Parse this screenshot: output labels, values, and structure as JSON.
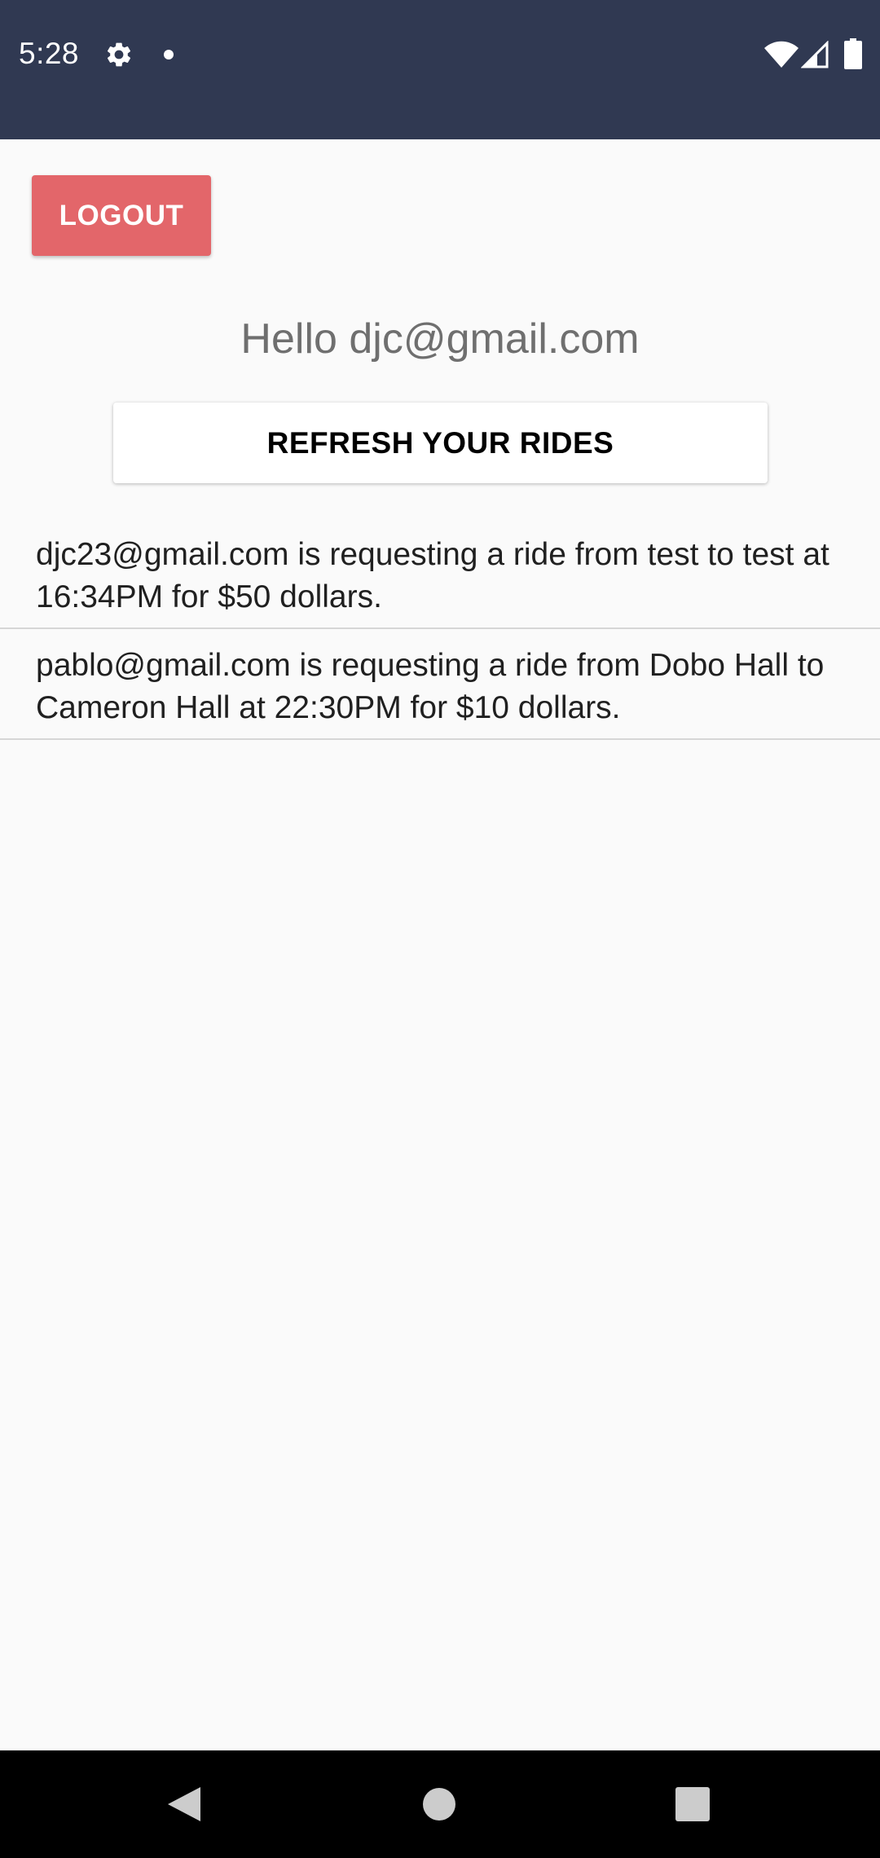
{
  "status_bar": {
    "time": "5:28",
    "icons": [
      "gear-icon",
      "notification-dot-icon",
      "wifi-icon",
      "cell-signal-icon",
      "battery-icon"
    ],
    "background_color": "#303952"
  },
  "main": {
    "logout_label": "LOGOUT",
    "logout_color": "#e3666a",
    "greeting": "Hello djc@gmail.com",
    "refresh_label": "REFRESH YOUR RIDES",
    "rides": [
      {
        "text": "djc23@gmail.com is requesting a ride from test to test at 16:34PM for $50 dollars."
      },
      {
        "text": "pablo@gmail.com is requesting a ride from Dobo Hall to Cameron Hall at 22:30PM for $10 dollars."
      }
    ]
  },
  "nav_bar": {
    "icons": [
      "back-icon",
      "home-icon",
      "recents-icon"
    ]
  }
}
